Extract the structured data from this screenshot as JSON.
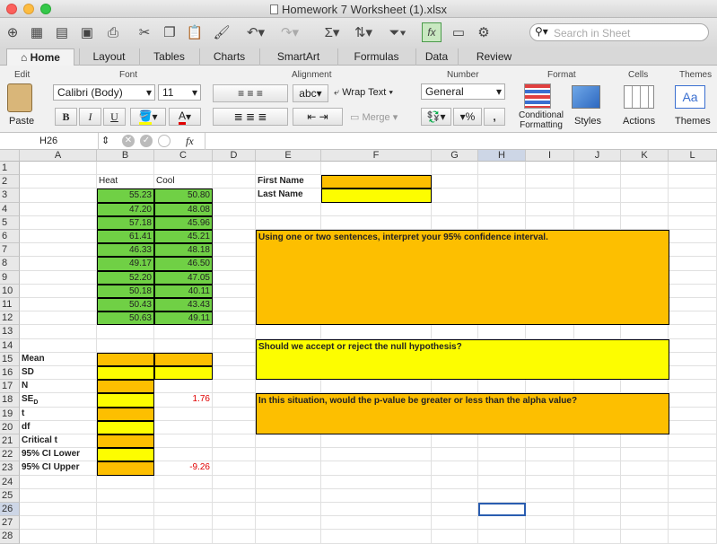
{
  "window": {
    "title": "Homework 7 Worksheet (1).xlsx"
  },
  "toolbar": {
    "search_placeholder": "Search in Sheet"
  },
  "tabs": [
    "Home",
    "Layout",
    "Tables",
    "Charts",
    "SmartArt",
    "Formulas",
    "Data",
    "Review"
  ],
  "ribbon": {
    "groups": [
      "Edit",
      "Font",
      "Alignment",
      "Number",
      "Format",
      "Cells",
      "Themes"
    ],
    "paste_label": "Paste",
    "font_name": "Calibri (Body)",
    "font_size": "11",
    "bold": "B",
    "italic": "I",
    "underline": "U",
    "font_color_glyph": "A",
    "wrap_text": "Wrap Text",
    "merge": "Merge",
    "orientation_label": "abc",
    "number_format": "General",
    "percent": "%",
    "comma": ",",
    "conditional_formatting": "Conditional Formatting",
    "styles": "Styles",
    "actions": "Actions",
    "themes": "Themes",
    "themes_sample": "Aa"
  },
  "formula_bar": {
    "name_box": "H26",
    "fx": "fx",
    "value": ""
  },
  "columns": [
    "A",
    "B",
    "C",
    "D",
    "E",
    "F",
    "G",
    "H",
    "I",
    "J",
    "K",
    "L"
  ],
  "rows": [
    "1",
    "2",
    "3",
    "4",
    "5",
    "6",
    "7",
    "8",
    "9",
    "10",
    "11",
    "12",
    "13",
    "14",
    "15",
    "16",
    "17",
    "18",
    "19",
    "20",
    "21",
    "22",
    "23",
    "24",
    "25",
    "26",
    "27",
    "28"
  ],
  "sheet": {
    "heat_header": "Heat",
    "cool_header": "Cool",
    "heat": [
      "55.23",
      "47.20",
      "57.18",
      "61.41",
      "46.33",
      "49.17",
      "52.20",
      "50.18",
      "50.43",
      "50.63"
    ],
    "cool": [
      "50.80",
      "48.08",
      "45.96",
      "45.21",
      "48.18",
      "46.50",
      "47.05",
      "40.11",
      "43.43",
      "49.11"
    ],
    "stat_labels": [
      "Mean",
      "SD",
      "N",
      "SE",
      "t",
      "df",
      "Critical t",
      "95% CI Lower",
      "95% CI Upper"
    ],
    "se_subscript": "D",
    "se_value": "1.76",
    "ci_upper_value": "-9.26",
    "first_name_label": "First Name",
    "last_name_label": "Last Name",
    "q1": "Using one or two sentences, interpret your 95% confidence interval.",
    "q2": "Should we accept or reject the null hypothesis?",
    "q3": "In this situation, would the p-value be greater or less than the alpha value?"
  },
  "colors": {
    "green": "#70d045",
    "orange": "#fdbf00",
    "yellow": "#fdfd00",
    "red_text": "#e00000"
  }
}
